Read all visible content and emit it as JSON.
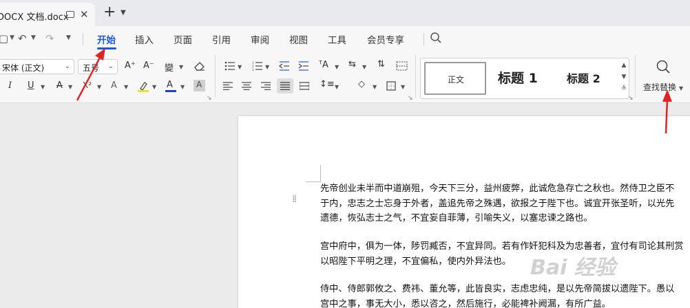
{
  "tabbar": {
    "doc_title": "DOCX 文档.docx",
    "close_glyph": "✕",
    "new_tab_glyph": "+",
    "caret_glyph": "⌄"
  },
  "menubar": {
    "tabs": [
      "开始",
      "插入",
      "页面",
      "引用",
      "审阅",
      "视图",
      "工具",
      "会员专享"
    ],
    "active_tab": "开始",
    "undo_glyph": "↶",
    "redo_glyph": "↷"
  },
  "ribbon": {
    "font_name": "宋体 (正文)",
    "font_size": "五号",
    "grow_font": "A⁺",
    "shrink_font": "A⁻",
    "phonetic": "變",
    "italic": "I",
    "underline": "U",
    "strike": "ꟻ",
    "superscript": "X²",
    "text_effect": "A",
    "font_color": "A",
    "shading_letter": "A",
    "styles": {
      "normal": "正文",
      "heading1": "标题 1",
      "heading2": "标题 2"
    },
    "find_replace_label": "查找替换",
    "accent_color": "#1d56d6",
    "annotation_color": "#e02424"
  },
  "document": {
    "paragraphs": [
      [
        "先帝创业未半而中道崩殂，今天下三分，益州疲弊，此诚危急存亡之秋也。然侍卫之臣不",
        "于内，忠志之士忘身于外者，盖追先帝之殊遇，欲报之于陛下也。诚宜开张圣听，以光先",
        "遗德，恢弘志士之气，不宜妄自菲薄，引喻失义，以塞忠谏之路也。"
      ],
      [
        "宫中府中，俱为一体，陟罚臧否，不宜异同。若有作奸犯科及为忠善者，宜付有司论其刑赏",
        "以昭陛下平明之理，不宜偏私，使内外异法也。"
      ],
      [
        "侍中、侍郎郭攸之、费祎、董允等，此皆良实，志虑忠纯，是以先帝简拔以遗陛下。愚以",
        "宫中之事，事无大小，悉以咨之，然后施行，必能裨补阙漏，有所广益。"
      ]
    ]
  },
  "watermark": "Bai 经验"
}
